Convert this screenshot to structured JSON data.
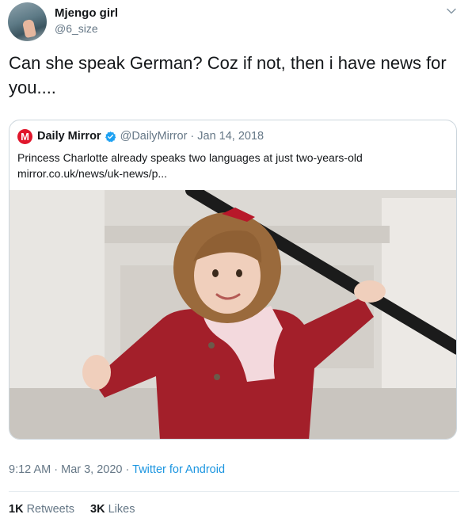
{
  "author": {
    "display_name": "Mjengo girl",
    "handle": "@6_size",
    "avatar_icon": "profile-photo"
  },
  "tweet": {
    "text": "Can she speak German? Coz if not, then i have news for you...."
  },
  "quoted": {
    "name": "Daily Mirror",
    "logo_letter": "M",
    "logo_color": "#e0162b",
    "verified_icon": "verified-badge-icon",
    "verified_color": "#1da1f2",
    "handle": "@DailyMirror",
    "separator": "·",
    "date": "Jan 14, 2018",
    "text": "Princess Charlotte already speaks two languages at just two-years-old",
    "link": "mirror.co.uk/news/uk-news/p..."
  },
  "meta": {
    "time": "9:12 AM",
    "separator": "·",
    "date": "Mar 3, 2020",
    "client": "Twitter for Android"
  },
  "stats": {
    "retweets_count": "1K",
    "retweets_label": "Retweets",
    "likes_count": "3K",
    "likes_label": "Likes"
  },
  "colors": {
    "link": "#1b95e0",
    "secondary_text": "#657786",
    "primary_text": "#14171a"
  }
}
